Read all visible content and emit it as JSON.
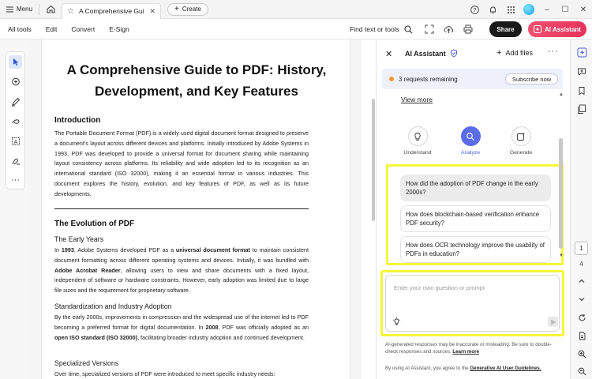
{
  "titlebar": {
    "menu_label": "Menu",
    "tab_title": "A Comprehensive Guid...",
    "create_label": "Create"
  },
  "toolbar": {
    "menus": [
      "All tools",
      "Edit",
      "Convert",
      "E-Sign"
    ],
    "find_label": "Find text or tools",
    "share_label": "Share",
    "ai_label": "AI Assistant"
  },
  "document": {
    "title": "A Comprehensive Guide to PDF: History, Development, and Key Features",
    "intro_heading": "Introduction",
    "intro_text": "The Portable Document Format (PDF) is a widely used digital document format designed to preserve a document's layout across different devices and platforms. Initially introduced by Adobe Systems in 1993, PDF was developed to provide a universal format for document sharing while maintaining layout consistency across platforms. Its reliability and wide adoption led to its recognition as an international standard (ISO 32000), making it an essential format in various industries. This document explores the history, evolution, and key features of PDF, as well as its future developments.",
    "evolution_heading": "The Evolution of PDF",
    "early_heading": "The Early Years",
    "early_text_1": "In ",
    "early_bold_1": "1993",
    "early_text_2": ", Adobe Systems developed PDF as a ",
    "early_bold_2": "universal document format",
    "early_text_3": " to maintain consistent document formatting across different operating systems and devices. Initially, it was bundled with ",
    "early_bold_3": "Adobe Acrobat Reader",
    "early_text_4": ", allowing users to view and share documents with a fixed layout, independent of software or hardware constraints. However, early adoption was limited due to large file sizes and the requirement for proprietary software.",
    "std_heading": "Standardization and Industry Adoption",
    "std_text_1": "By the early 2000s, improvements in compression and the widespread use of the internet led to PDF becoming a preferred format for digital documentation. In ",
    "std_bold_1": "2008",
    "std_text_2": ", PDF was officially adopted as an ",
    "std_bold_2": "open ISO standard (ISO 32000)",
    "std_text_3": ", facilitating broader industry adoption and continued development.",
    "spec_heading": "Specialized Versions",
    "spec_text": "Over time, specialized versions of PDF were introduced to meet specific industry needs:"
  },
  "ai_panel": {
    "title": "AI Assistant",
    "add_files_label": "Add files",
    "requests_text": "3 requests remaining",
    "subscribe_label": "Subscribe now",
    "view_more_label": "View more",
    "actions": [
      {
        "label": "Understand"
      },
      {
        "label": "Analyze"
      },
      {
        "label": "Generate"
      }
    ],
    "suggestions": [
      "How did the adoption of PDF change in the early 2000s?",
      "How does blockchain-based verification enhance PDF security?",
      "How does OCR technology improve the usability of PDFs in education?"
    ],
    "input_placeholder": "Enter your own question or prompt",
    "disclaimer_text": "AI-generated responses may be inaccurate or misleading. Be sure to double-check responses and sources.",
    "learn_more_label": "Learn more",
    "terms_text": "By using AI Assistant, you agree to the",
    "terms_link": "Generative AI User Guidelines."
  },
  "right_rail": {
    "current_page": "1",
    "total_pages": "4"
  },
  "colors": {
    "accent": "#5a6ce8",
    "ai_button": "#e8325c",
    "highlight": "#f5f53a",
    "badge_dot": "#f29a2e"
  }
}
